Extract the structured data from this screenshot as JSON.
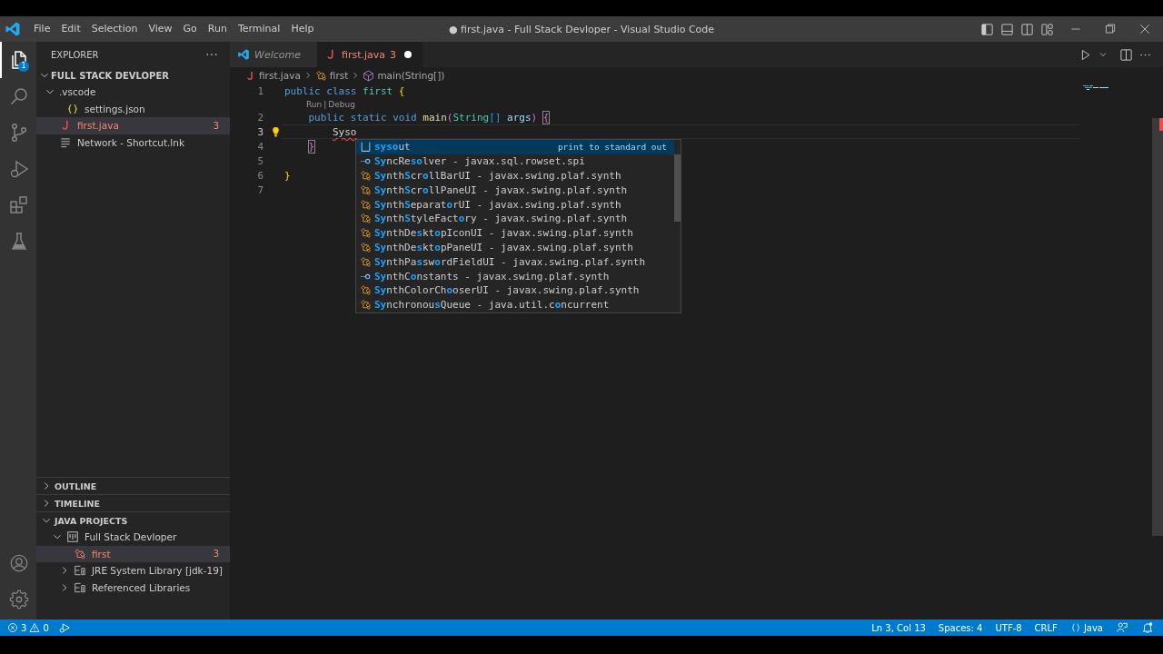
{
  "menu": [
    "File",
    "Edit",
    "Selection",
    "View",
    "Go",
    "Run",
    "Terminal",
    "Help"
  ],
  "window": {
    "title": "● first.java - Full Stack Devloper - Visual Studio Code"
  },
  "activity_bar": [
    {
      "kind": "files",
      "selected": true,
      "badge": "1"
    },
    {
      "kind": "search",
      "selected": false
    },
    {
      "kind": "source-control",
      "selected": false
    },
    {
      "kind": "run-debug",
      "selected": false
    },
    {
      "kind": "extensions",
      "selected": false
    },
    {
      "kind": "testing",
      "selected": false
    }
  ],
  "activity_bottom": [
    {
      "kind": "account"
    },
    {
      "kind": "settings"
    }
  ],
  "sidebar": {
    "title": "EXPLORER",
    "folder": {
      "label": "FULL STACK DEVLOPER",
      "expanded": true,
      "children": [
        {
          "label": ".vscode",
          "kind": "folder",
          "expanded": true,
          "selected": false,
          "children": [
            {
              "label": "settings.json",
              "kind": "json",
              "selected": false
            }
          ]
        },
        {
          "label": "first.java",
          "kind": "java",
          "selected": true,
          "error": true,
          "badge": "3"
        },
        {
          "label": "Network - Shortcut.lnk",
          "kind": "lines",
          "selected": false
        }
      ]
    },
    "sections": [
      {
        "label": "OUTLINE",
        "expanded": false
      },
      {
        "label": "TIMELINE",
        "expanded": false
      },
      {
        "label": "JAVA PROJECTS",
        "expanded": true,
        "children": [
          {
            "label": "Full Stack Devloper",
            "kind": "project",
            "expanded": true,
            "selected": false,
            "children": [
              {
                "label": "first",
                "kind": "class",
                "selected": true,
                "error": true,
                "badge": "3"
              },
              {
                "label": "JRE System Library [jdk-19]",
                "kind": "library",
                "expanded": false,
                "selected": false
              },
              {
                "label": "Referenced Libraries",
                "kind": "library",
                "expanded": false,
                "selected": false
              }
            ]
          }
        ]
      }
    ]
  },
  "tabs": [
    {
      "label": "Welcome",
      "kind": "welcome",
      "selected": false,
      "preview": true
    },
    {
      "label": "first.java",
      "kind": "java",
      "selected": true,
      "error": true,
      "badge": "3",
      "modified": true
    }
  ],
  "breadcrumb": [
    {
      "label": "first.java",
      "kind": "java"
    },
    {
      "label": "first",
      "kind": "class"
    },
    {
      "label": "main(String[])",
      "kind": "method"
    }
  ],
  "lines": [
    {
      "kind": "code",
      "number": "1",
      "tokens": [
        {
          "text": "public class",
          "kind": "keyword"
        },
        {
          "text": " first",
          "kind": "type"
        },
        {
          "text": " {",
          "kind": "bracket1"
        }
      ]
    },
    {
      "kind": "codelens",
      "links": [
        "Run",
        "Debug"
      ],
      "separator": "|"
    },
    {
      "kind": "code",
      "number": "2",
      "tokens": [
        {
          "text": "    public static void",
          "kind": "keyword"
        },
        {
          "text": " main",
          "kind": "func"
        },
        {
          "text": "(",
          "kind": "bracket2"
        },
        {
          "text": "String",
          "kind": "type"
        },
        {
          "text": "[]",
          "kind": "bracket3"
        },
        {
          "text": " args",
          "kind": "param"
        },
        {
          "text": ")",
          "kind": "bracket2"
        },
        {
          "text": " {",
          "kind": "bracket2",
          "boxed": true
        }
      ]
    },
    {
      "kind": "code",
      "number": "3",
      "current": true,
      "lightbulb": true,
      "tokens": [
        {
          "text": "        Syso",
          "kind": "error"
        }
      ]
    },
    {
      "kind": "code",
      "number": "4",
      "tokens": [
        {
          "text": "    }",
          "kind": "bracket2",
          "boxed": true
        }
      ]
    },
    {
      "kind": "code",
      "number": "5"
    },
    {
      "kind": "code",
      "number": "6",
      "tokens": [
        {
          "text": "}",
          "kind": "bracket1"
        }
      ]
    },
    {
      "kind": "code",
      "number": "7"
    }
  ],
  "suggestions": [
    {
      "kind": "snippet",
      "label": "**syso**ut",
      "detail": "print to standard out",
      "selected": true
    },
    {
      "kind": "interface",
      "label": "**Sy**ncRe**so**lver",
      "detail": " - javax.sql.rowset.spi",
      "selected": false
    },
    {
      "kind": "class",
      "label": "**Sy**nth**S**cr**o**llBarUI",
      "detail": " - javax.swing.plaf.synth",
      "selected": false
    },
    {
      "kind": "class",
      "label": "**Sy**nth**S**cr**o**llPaneUI",
      "detail": " - javax.swing.plaf.synth",
      "selected": false
    },
    {
      "kind": "class",
      "label": "**Sy**nth**S**eparat**o**rUI",
      "detail": " - javax.swing.plaf.synth",
      "selected": false
    },
    {
      "kind": "class",
      "label": "**Sy**nth**S**tyleFact**o**ry",
      "detail": " - javax.swing.plaf.synth",
      "selected": false
    },
    {
      "kind": "class",
      "label": "**Sy**nthDe**s**kt**o**pIconUI",
      "detail": " - javax.swing.plaf.synth",
      "selected": false
    },
    {
      "kind": "class",
      "label": "**Sy**nthDe**s**kt**o**pPaneUI",
      "detail": " - javax.swing.plaf.synth",
      "selected": false
    },
    {
      "kind": "class",
      "label": "**Sy**nthPa**s**sw**o**rdFieldUI",
      "detail": " - javax.swing.plaf.synth",
      "selected": false
    },
    {
      "kind": "interface",
      "label": "**Sy**nthC**o**nstants",
      "detail": " - javax.swing.plaf.synth",
      "selected": false
    },
    {
      "kind": "class",
      "label": "**Sy**nthColorCh**o**oserUI",
      "detail": " - javax.swing.plaf.synth",
      "selected": false
    },
    {
      "kind": "class",
      "label": "**Sy**nchronou**s**Queue",
      "detail": " - java.util.c**o**ncurrent",
      "selected": false
    }
  ],
  "status_bar": {
    "errors": "3",
    "warnings": "0",
    "right": [
      {
        "kind": "text",
        "label": "Ln 3, Col 13"
      },
      {
        "kind": "text",
        "label": "Spaces: 4"
      },
      {
        "kind": "text",
        "label": "UTF-8"
      },
      {
        "kind": "text",
        "label": "CRLF"
      },
      {
        "kind": "language",
        "label": "Java"
      },
      {
        "kind": "feedback"
      },
      {
        "kind": "bell"
      }
    ]
  }
}
